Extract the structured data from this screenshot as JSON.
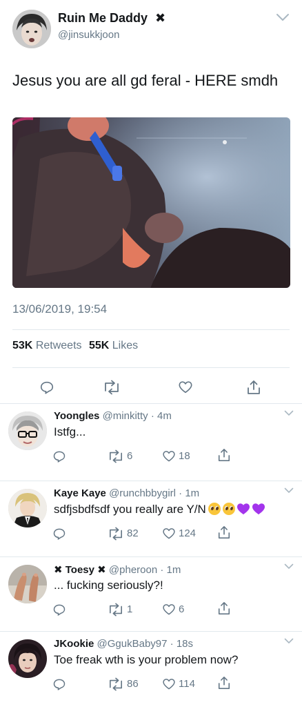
{
  "main_tweet": {
    "display_name": "Ruin Me Daddy",
    "name_badge": "✖",
    "handle": "@jinsukkjoon",
    "text": "Jesus you are all gd feral - HERE smdh",
    "timestamp": "13/06/2019, 19:54",
    "retweets_count": "53K",
    "retweets_label": "Retweets",
    "likes_count": "55K",
    "likes_label": "Likes"
  },
  "replies": [
    {
      "name": "Yoongles",
      "handle": "@minkitty",
      "time": "· 4m",
      "text": "Istfg...",
      "retweets": "6",
      "likes": "18"
    },
    {
      "name": "Kaye Kaye",
      "handle": "@runchbbygirl",
      "time": "· 1m",
      "text": "sdfjsbdfsdf you really are Y/N",
      "emojis": [
        "pleading-face",
        "pleading-face",
        "purple-heart",
        "purple-heart"
      ],
      "retweets": "82",
      "likes": "124"
    },
    {
      "name_prefix": "✖",
      "name": "Toesy",
      "name_suffix": "✖",
      "handle": "@pheroon",
      "time": "· 1m",
      "text": "... fucking seriously?!",
      "retweets": "1",
      "likes": "6"
    },
    {
      "name": "JKookie",
      "handle": "@GgukBaby97",
      "time": "· 18s",
      "text": "Toe freak wth is your problem now?",
      "retweets": "86",
      "likes": "114"
    }
  ],
  "colors": {
    "text": "#14171a",
    "secondary": "#657786",
    "divider": "#e1e8ed",
    "icon": "#657786",
    "purple_heart": "#a334ec"
  },
  "icons": [
    "reply-icon",
    "retweet-icon",
    "like-icon",
    "share-icon",
    "chevron-down-icon"
  ]
}
